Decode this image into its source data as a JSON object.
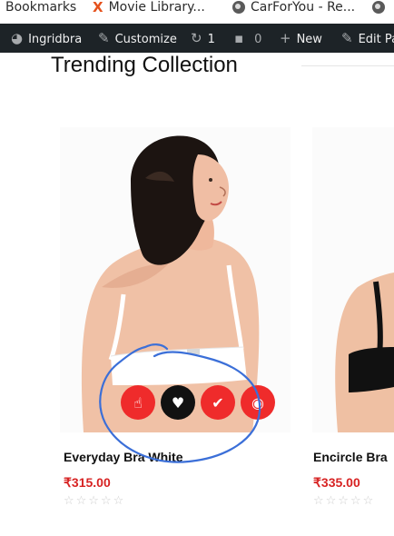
{
  "bookmarks": [
    {
      "label": "Bookmarks"
    },
    {
      "label": "Movie Library...",
      "icon": "x-icon"
    },
    {
      "label": "CarForYou - Re...",
      "icon": "globe-icon"
    }
  ],
  "adminbar": {
    "site": "Ingridbra",
    "customize": "Customize",
    "updates": "1",
    "comments": "0",
    "new": "New",
    "edit": "Edit Pa"
  },
  "section": {
    "title": "Trending Collection"
  },
  "products": [
    {
      "name": "Everyday Bra White",
      "price": "₹315.00",
      "rating": "☆☆☆☆☆"
    },
    {
      "name": "Encircle Bra",
      "price": "₹335.00",
      "rating": "☆☆☆☆☆"
    }
  ],
  "colors": {
    "accent": "#ef2b2b",
    "price": "#d72323",
    "adminbar": "#1d2327",
    "annotation": "#3b6fd8"
  }
}
